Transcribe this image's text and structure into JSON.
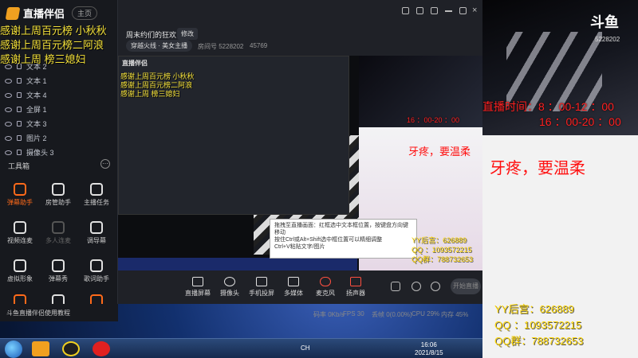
{
  "app": {
    "name": "直播伴侣",
    "mode": "主页",
    "room_title": "周末约们的狂欢",
    "edit_label": "修改",
    "category": "穿越火线 · 美女主播",
    "room_id": "房间号 5228202",
    "fans": "45769"
  },
  "overlay": {
    "line1": "感谢上周百元榜   小秋秋",
    "line2": "感谢上周百元榜二阿浪",
    "line3": "感谢上周      榜三媳妇",
    "small1": "感谢上周百元榜  小秋秋",
    "small2": "感谢上周百元榜二阿浪",
    "small3": "感谢上周      榜三媳妇"
  },
  "layers": [
    {
      "label": "文本 2"
    },
    {
      "label": "文本 1"
    },
    {
      "label": "文本 4"
    },
    {
      "label": "全屏 1"
    },
    {
      "label": "文本 3"
    },
    {
      "label": "图片 2"
    },
    {
      "label": "摄像头 3"
    }
  ],
  "tools": {
    "title": "工具箱",
    "items": [
      {
        "label": "弹幕助手",
        "active": true
      },
      {
        "label": "房管助手"
      },
      {
        "label": "主播任务"
      },
      {
        "label": "视频连麦"
      },
      {
        "label": "多人连麦",
        "dim": true
      },
      {
        "label": "调导幕"
      },
      {
        "label": "虚拟形象"
      },
      {
        "label": "弹幕秀"
      },
      {
        "label": "歌词助手"
      }
    ]
  },
  "sidebar_footer": "斗鱼直播伴侣使用教程",
  "toolbar": {
    "items": [
      {
        "label": "直播屏幕"
      },
      {
        "label": "摄像头"
      },
      {
        "label": "手机投屏"
      },
      {
        "label": "多媒体"
      },
      {
        "label": "麦克风"
      },
      {
        "label": "扬声器"
      }
    ],
    "live_label": "开始直播"
  },
  "status": {
    "bitrate": "码率 0Kb/s",
    "fps": "FPS 30",
    "drop": "丢帧 0(0.00%)",
    "cpu": "CPU 29%",
    "mem": "内存 45%"
  },
  "preview": {
    "nested_title": "直播伴侣",
    "tooltip_lines": [
      "拖拽至直播画面：红框选中文本框位置，按键盘方向键移动",
      "按住Ctrl或Alt+Shift选中框位置可以精细调整",
      "Ctrl+V粘贴文字/图片"
    ],
    "stamp": "5228202"
  },
  "taskbar": {
    "ime": "CH",
    "time": "16:06",
    "date": "2021/8/15"
  },
  "stream": {
    "brand": "斗鱼",
    "room": "5228202",
    "schedule1": "直播时间：8 ：00-12 ：00",
    "schedule2": "16 ：00-20 ：00",
    "slogan": "牙疼，要温柔",
    "yy": "YY后宫：626889",
    "qq": "QQ    ：1093572215",
    "qqgroup": "QQ群：788732653"
  }
}
